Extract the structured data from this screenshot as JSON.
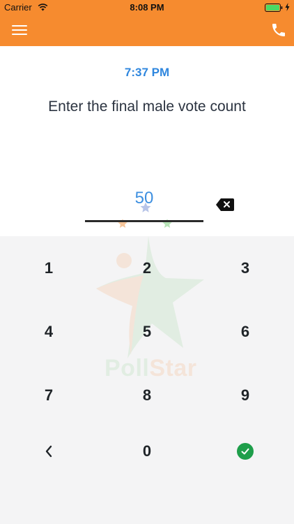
{
  "status_bar": {
    "carrier": "Carrier",
    "time": "8:08 PM"
  },
  "nav": {
    "menu_icon": "hamburger-menu-icon",
    "phone_icon": "phone-icon",
    "background_color": "#f68b2f"
  },
  "prompt": {
    "time": "7:37 PM",
    "question": "Enter the final male vote count"
  },
  "entry": {
    "value": "50",
    "backspace_icon": "backspace-icon"
  },
  "keypad": {
    "keys": [
      "1",
      "2",
      "3",
      "4",
      "5",
      "6",
      "7",
      "8",
      "9"
    ],
    "back_icon": "chevron-left-icon",
    "zero": "0",
    "confirm_icon": "check-circle-icon",
    "confirm_color": "#1e9e4a"
  },
  "watermark": {
    "part1": "Poll",
    "part2": "Star"
  },
  "colors": {
    "accent": "#2e86de",
    "keypad_bg": "#f4f4f5"
  }
}
